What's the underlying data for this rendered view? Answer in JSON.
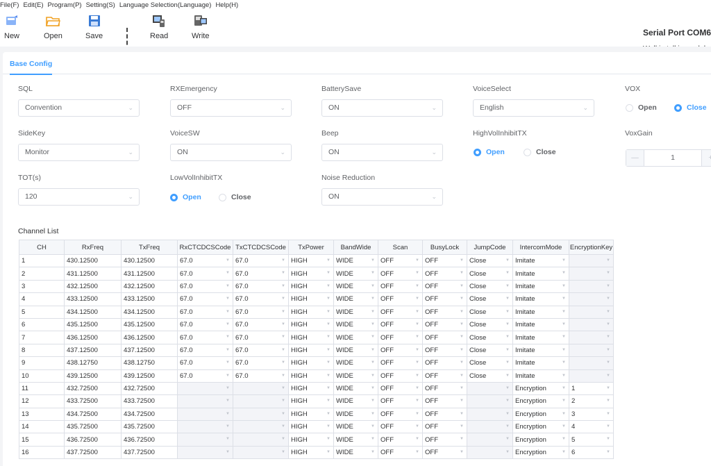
{
  "menu": [
    "File(F)",
    "Edit(E)",
    "Program(P)",
    "Setting(S)",
    "Language Selection(Language)",
    "Help(H)"
  ],
  "toolbar": {
    "new": "New",
    "open": "Open",
    "save": "Save",
    "read": "Read",
    "write": "Write"
  },
  "header": {
    "serial": "Serial Port COM6",
    "model": "Walkie talkie model"
  },
  "tab": "Base Config",
  "fields": {
    "sql": {
      "label": "SQL",
      "value": "Convention"
    },
    "rxemergency": {
      "label": "RXEmergency",
      "value": "OFF"
    },
    "batterysave": {
      "label": "BatterySave",
      "value": "ON"
    },
    "voiceselect": {
      "label": "VoiceSelect",
      "value": "English"
    },
    "vox": {
      "label": "VOX",
      "open": "Open",
      "close": "Close",
      "selected": "Close"
    },
    "sidekey": {
      "label": "SideKey",
      "value": "Monitor"
    },
    "voicesw": {
      "label": "VoiceSW",
      "value": "ON"
    },
    "beep": {
      "label": "Beep",
      "value": "ON"
    },
    "highvol": {
      "label": "HighVolInhibitTX",
      "open": "Open",
      "close": "Close",
      "selected": "Open"
    },
    "voxgain": {
      "label": "VoxGain",
      "minus": "—",
      "value": "1",
      "plus": "+"
    },
    "tot": {
      "label": "TOT(s)",
      "value": "120"
    },
    "lowvol": {
      "label": "LowVolInhibitTX",
      "open": "Open",
      "close": "Close",
      "selected": "Open"
    },
    "noise": {
      "label": "Noise Reduction",
      "value": "ON"
    }
  },
  "channel_list": {
    "title": "Channel List",
    "columns": [
      "CH",
      "RxFreq",
      "TxFreq",
      "RxCTCDCSCode",
      "TxCTCDCSCode",
      "TxPower",
      "BandWide",
      "Scan",
      "BusyLock",
      "JumpCode",
      "IntercomMode",
      "EncryptionKey"
    ],
    "rows": [
      [
        "1",
        "430.12500",
        "430.12500",
        "67.0",
        "67.0",
        "HIGH",
        "WIDE",
        "OFF",
        "OFF",
        "Close",
        "Imitate",
        ""
      ],
      [
        "2",
        "431.12500",
        "431.12500",
        "67.0",
        "67.0",
        "HIGH",
        "WIDE",
        "OFF",
        "OFF",
        "Close",
        "Imitate",
        ""
      ],
      [
        "3",
        "432.12500",
        "432.12500",
        "67.0",
        "67.0",
        "HIGH",
        "WIDE",
        "OFF",
        "OFF",
        "Close",
        "Imitate",
        ""
      ],
      [
        "4",
        "433.12500",
        "433.12500",
        "67.0",
        "67.0",
        "HIGH",
        "WIDE",
        "OFF",
        "OFF",
        "Close",
        "Imitate",
        ""
      ],
      [
        "5",
        "434.12500",
        "434.12500",
        "67.0",
        "67.0",
        "HIGH",
        "WIDE",
        "OFF",
        "OFF",
        "Close",
        "Imitate",
        ""
      ],
      [
        "6",
        "435.12500",
        "435.12500",
        "67.0",
        "67.0",
        "HIGH",
        "WIDE",
        "OFF",
        "OFF",
        "Close",
        "Imitate",
        ""
      ],
      [
        "7",
        "436.12500",
        "436.12500",
        "67.0",
        "67.0",
        "HIGH",
        "WIDE",
        "OFF",
        "OFF",
        "Close",
        "Imitate",
        ""
      ],
      [
        "8",
        "437.12500",
        "437.12500",
        "67.0",
        "67.0",
        "HIGH",
        "WIDE",
        "OFF",
        "OFF",
        "Close",
        "Imitate",
        ""
      ],
      [
        "9",
        "438.12750",
        "438.12750",
        "67.0",
        "67.0",
        "HIGH",
        "WIDE",
        "OFF",
        "OFF",
        "Close",
        "Imitate",
        ""
      ],
      [
        "10",
        "439.12500",
        "439.12500",
        "67.0",
        "67.0",
        "HIGH",
        "WIDE",
        "OFF",
        "OFF",
        "Close",
        "Imitate",
        ""
      ],
      [
        "11",
        "432.72500",
        "432.72500",
        "",
        "",
        "HIGH",
        "WIDE",
        "OFF",
        "OFF",
        "",
        "Encryption",
        "1"
      ],
      [
        "12",
        "433.72500",
        "433.72500",
        "",
        "",
        "HIGH",
        "WIDE",
        "OFF",
        "OFF",
        "",
        "Encryption",
        "2"
      ],
      [
        "13",
        "434.72500",
        "434.72500",
        "",
        "",
        "HIGH",
        "WIDE",
        "OFF",
        "OFF",
        "",
        "Encryption",
        "3"
      ],
      [
        "14",
        "435.72500",
        "435.72500",
        "",
        "",
        "HIGH",
        "WIDE",
        "OFF",
        "OFF",
        "",
        "Encryption",
        "4"
      ],
      [
        "15",
        "436.72500",
        "436.72500",
        "",
        "",
        "HIGH",
        "WIDE",
        "OFF",
        "OFF",
        "",
        "Encryption",
        "5"
      ],
      [
        "16",
        "437.72500",
        "437.72500",
        "",
        "",
        "HIGH",
        "WIDE",
        "OFF",
        "OFF",
        "",
        "Encryption",
        "6"
      ]
    ]
  },
  "colors": {
    "accent": "#409eff",
    "border": "#dcdfe6",
    "header_bg": "#f5f7fa"
  }
}
